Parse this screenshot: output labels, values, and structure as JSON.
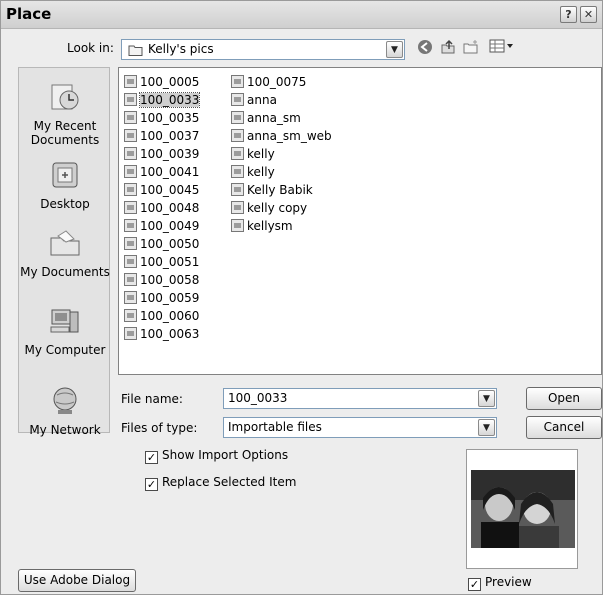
{
  "window": {
    "title": "Place",
    "help_label": "?",
    "close_label": "✕"
  },
  "lookin": {
    "label": "Look in:",
    "value": "Kelly's pics"
  },
  "toolbar": {
    "back_icon": "back-arrow-icon",
    "up_icon": "up-folder-icon",
    "new_folder_icon": "new-folder-icon",
    "view_icon": "view-menu-icon"
  },
  "places": [
    {
      "label": "My Recent Documents",
      "icon": "recent-documents-icon"
    },
    {
      "label": "Desktop",
      "icon": "desktop-icon"
    },
    {
      "label": "My Documents",
      "icon": "my-documents-icon"
    },
    {
      "label": "My Computer",
      "icon": "my-computer-icon"
    },
    {
      "label": "My Network",
      "icon": "my-network-icon"
    }
  ],
  "files_col1": [
    "100_0005",
    "100_0033",
    "100_0035",
    "100_0037",
    "100_0039",
    "100_0041",
    "100_0045",
    "100_0048",
    "100_0049",
    "100_0050",
    "100_0051",
    "100_0058",
    "100_0059",
    "100_0060",
    "100_0063"
  ],
  "files_col2": [
    "100_0075",
    "anna",
    "anna_sm",
    "anna_sm_web",
    "kelly",
    "kelly",
    "Kelly Babik",
    "kelly copy",
    "kellysm"
  ],
  "selected_file": "100_0033",
  "filename": {
    "label": "File name:",
    "value": "100_0033"
  },
  "filetype": {
    "label": "Files of type:",
    "value": "Importable files"
  },
  "buttons": {
    "open": "Open",
    "cancel": "Cancel",
    "adobe_dialog": "Use Adobe Dialog"
  },
  "options": {
    "show_import": "Show Import Options",
    "replace_selected": "Replace Selected Item",
    "preview": "Preview"
  }
}
